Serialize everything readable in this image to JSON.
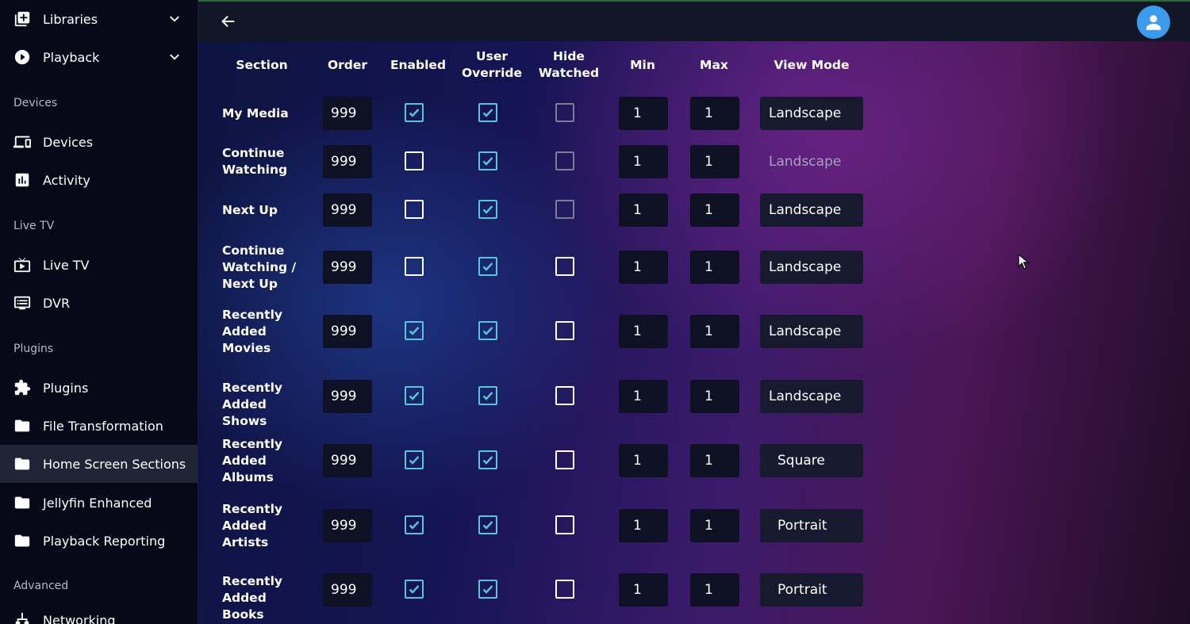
{
  "sidebar": {
    "top_items": [
      {
        "label": "Libraries",
        "icon": "add-box-icon"
      },
      {
        "label": "Playback",
        "icon": "play-circle-icon"
      }
    ],
    "sections": [
      {
        "header": "Devices",
        "items": [
          {
            "label": "Devices",
            "icon": "devices-icon"
          },
          {
            "label": "Activity",
            "icon": "activity-chart-icon"
          }
        ]
      },
      {
        "header": "Live TV",
        "items": [
          {
            "label": "Live TV",
            "icon": "live-tv-icon"
          },
          {
            "label": "DVR",
            "icon": "dvr-icon"
          }
        ]
      },
      {
        "header": "Plugins",
        "items": [
          {
            "label": "Plugins",
            "icon": "puzzle-icon"
          },
          {
            "label": "File Transformation",
            "icon": "folder-icon"
          },
          {
            "label": "Home Screen Sections",
            "icon": "folder-icon",
            "active": true
          },
          {
            "label": "Jellyfin Enhanced",
            "icon": "folder-icon"
          },
          {
            "label": "Playback Reporting",
            "icon": "folder-icon"
          }
        ]
      },
      {
        "header": "Advanced",
        "items": [
          {
            "label": "Networking",
            "icon": "network-icon"
          }
        ]
      }
    ]
  },
  "table": {
    "headers": {
      "section": "Section",
      "order": "Order",
      "enabled": "Enabled",
      "user_override": "User Override",
      "hide_watched": "Hide Watched",
      "min": "Min",
      "max": "Max",
      "view_mode": "View Mode"
    },
    "rows": [
      {
        "section": "My Media",
        "order": "999",
        "enabled": true,
        "user_override": true,
        "hide_watched": false,
        "hide_watched_disabled": true,
        "min": "1",
        "max": "1",
        "view_mode": "Landscape",
        "view_mode_disabled": false
      },
      {
        "section": "Continue Watching",
        "order": "999",
        "enabled": false,
        "user_override": true,
        "hide_watched": false,
        "hide_watched_disabled": true,
        "min": "1",
        "max": "1",
        "view_mode": "Landscape",
        "view_mode_disabled": true
      },
      {
        "section": "Next Up",
        "order": "999",
        "enabled": false,
        "user_override": true,
        "hide_watched": false,
        "hide_watched_disabled": true,
        "min": "1",
        "max": "1",
        "view_mode": "Landscape",
        "view_mode_disabled": false
      },
      {
        "section": "Continue Watching / Next Up",
        "order": "999",
        "enabled": false,
        "user_override": true,
        "hide_watched": false,
        "hide_watched_disabled": false,
        "min": "1",
        "max": "1",
        "view_mode": "Landscape",
        "view_mode_disabled": false
      },
      {
        "section": "Recently Added Movies",
        "order": "999",
        "enabled": true,
        "user_override": true,
        "hide_watched": false,
        "hide_watched_disabled": false,
        "min": "1",
        "max": "1",
        "view_mode": "Landscape",
        "view_mode_disabled": false
      },
      {
        "section": "Recently Added Shows",
        "order": "999",
        "enabled": true,
        "user_override": true,
        "hide_watched": false,
        "hide_watched_disabled": false,
        "min": "1",
        "max": "1",
        "view_mode": "Landscape",
        "view_mode_disabled": false
      },
      {
        "section": "Recently Added Albums",
        "order": "999",
        "enabled": true,
        "user_override": true,
        "hide_watched": false,
        "hide_watched_disabled": false,
        "min": "1",
        "max": "1",
        "view_mode": "Square",
        "view_mode_disabled": false
      },
      {
        "section": "Recently Added Artists",
        "order": "999",
        "enabled": true,
        "user_override": true,
        "hide_watched": false,
        "hide_watched_disabled": false,
        "min": "1",
        "max": "1",
        "view_mode": "Portrait",
        "view_mode_disabled": false
      },
      {
        "section": "Recently Added Books",
        "order": "999",
        "enabled": true,
        "user_override": true,
        "hide_watched": false,
        "hide_watched_disabled": false,
        "min": "1",
        "max": "1",
        "view_mode": "Portrait",
        "view_mode_disabled": false
      }
    ]
  },
  "colors": {
    "accent_checkbox": "#55c7d6",
    "avatar": "#3d9bec",
    "sidebar_bg": "#060818",
    "active_item_bg": "#1f2436"
  },
  "icons": {
    "back": "arrow-left-icon",
    "user": "user-avatar-icon",
    "expand": "chevron-down-icon"
  }
}
